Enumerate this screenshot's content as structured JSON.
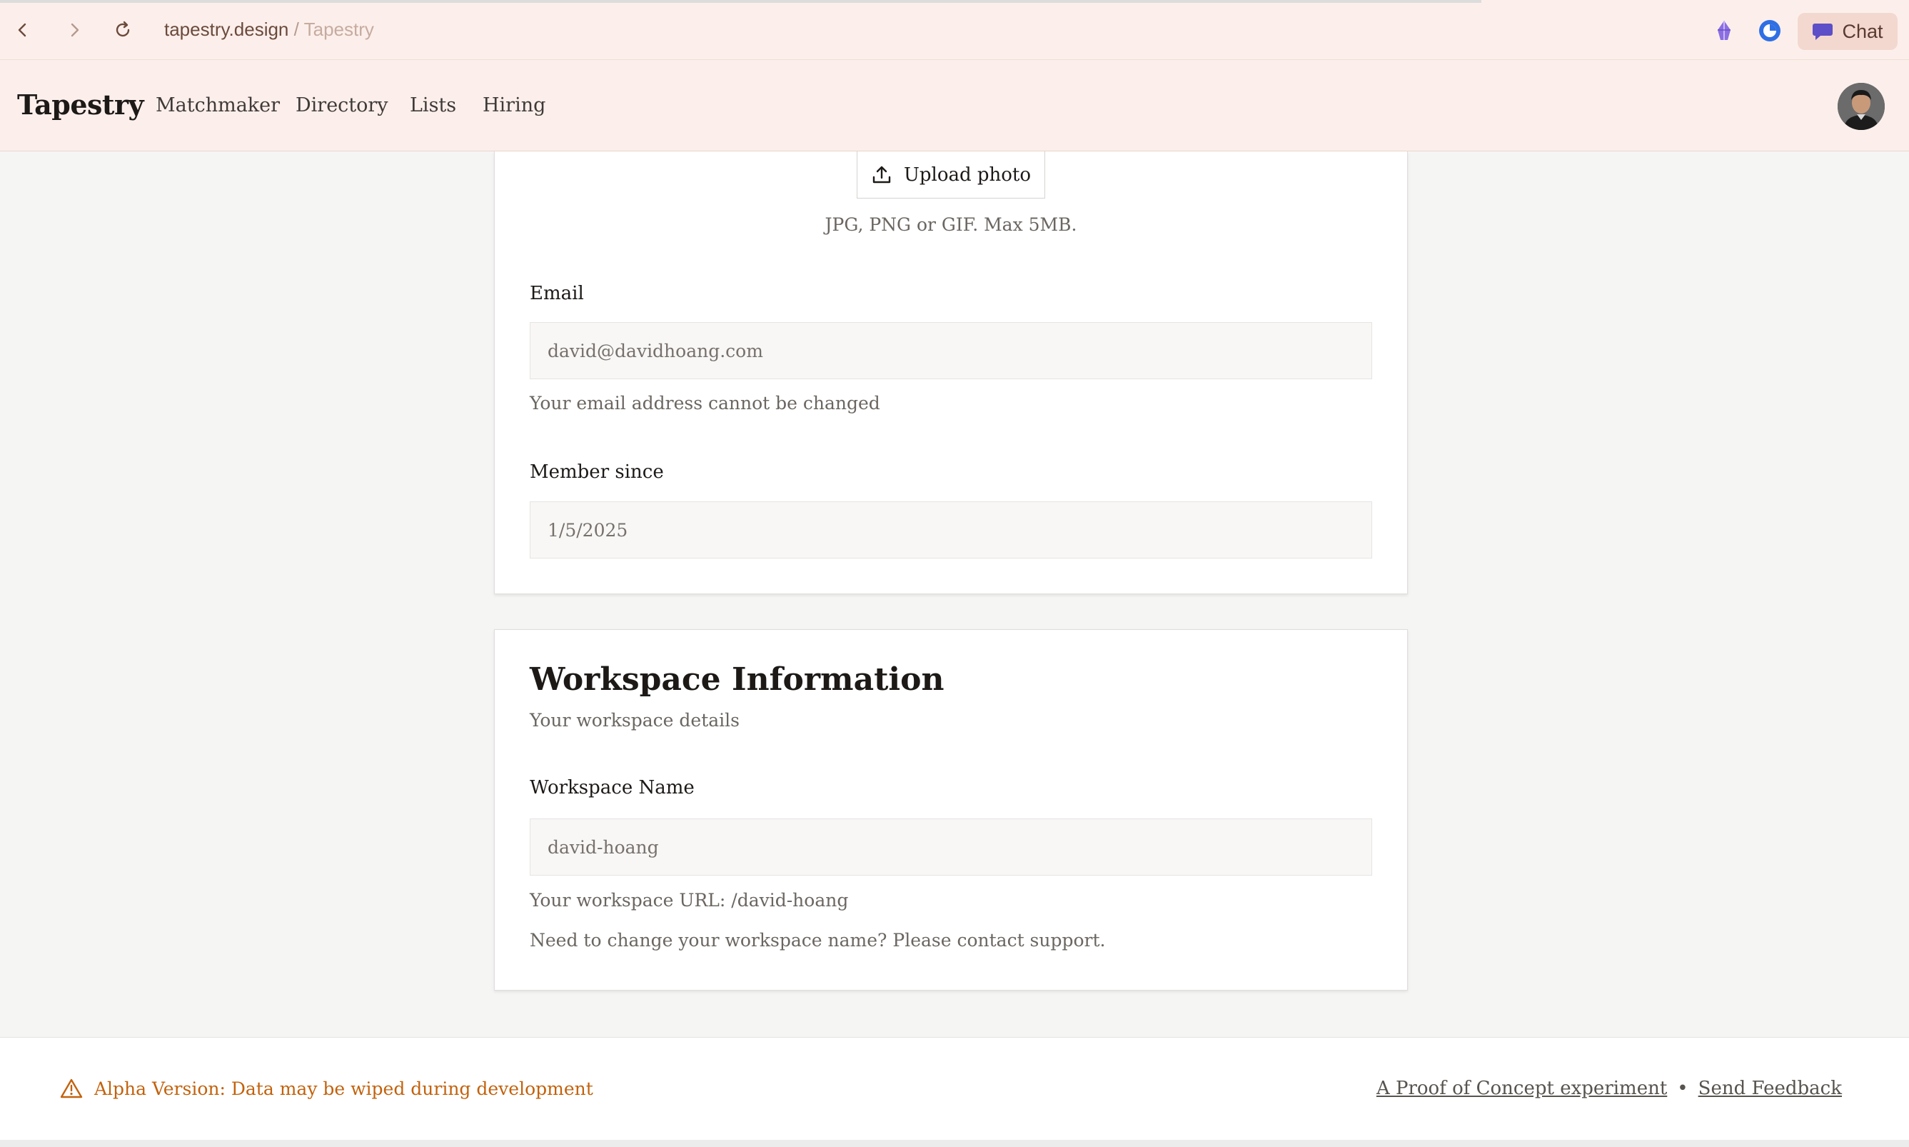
{
  "browser": {
    "site": "tapestry.design",
    "separator": "/",
    "page_title": "Tapestry",
    "chat_label": "Chat"
  },
  "header": {
    "logo": "Tapestry",
    "nav": [
      "Matchmaker",
      "Directory",
      "Lists",
      "Hiring"
    ]
  },
  "profile_card": {
    "upload_label": "Upload photo",
    "upload_hint": "JPG, PNG or GIF. Max 5MB.",
    "email_label": "Email",
    "email_value": "david@davidhoang.com",
    "email_help": "Your email address cannot be changed",
    "member_label": "Member since",
    "member_value": "1/5/2025"
  },
  "workspace_card": {
    "title": "Workspace Information",
    "subtitle": "Your workspace details",
    "name_label": "Workspace Name",
    "name_value": "david-hoang",
    "url_help": "Your workspace URL: /david-hoang",
    "support_help": "Need to change your workspace name? Please contact support."
  },
  "footer": {
    "alpha_notice": "Alpha Version: Data may be wiped during development",
    "poc_link": "A Proof of Concept experiment",
    "bullet": "•",
    "feedback_link": "Send Feedback"
  },
  "colors": {
    "header_bg": "#fcefeb",
    "page_bg": "#f5f5f4",
    "warning": "#c2620d"
  }
}
